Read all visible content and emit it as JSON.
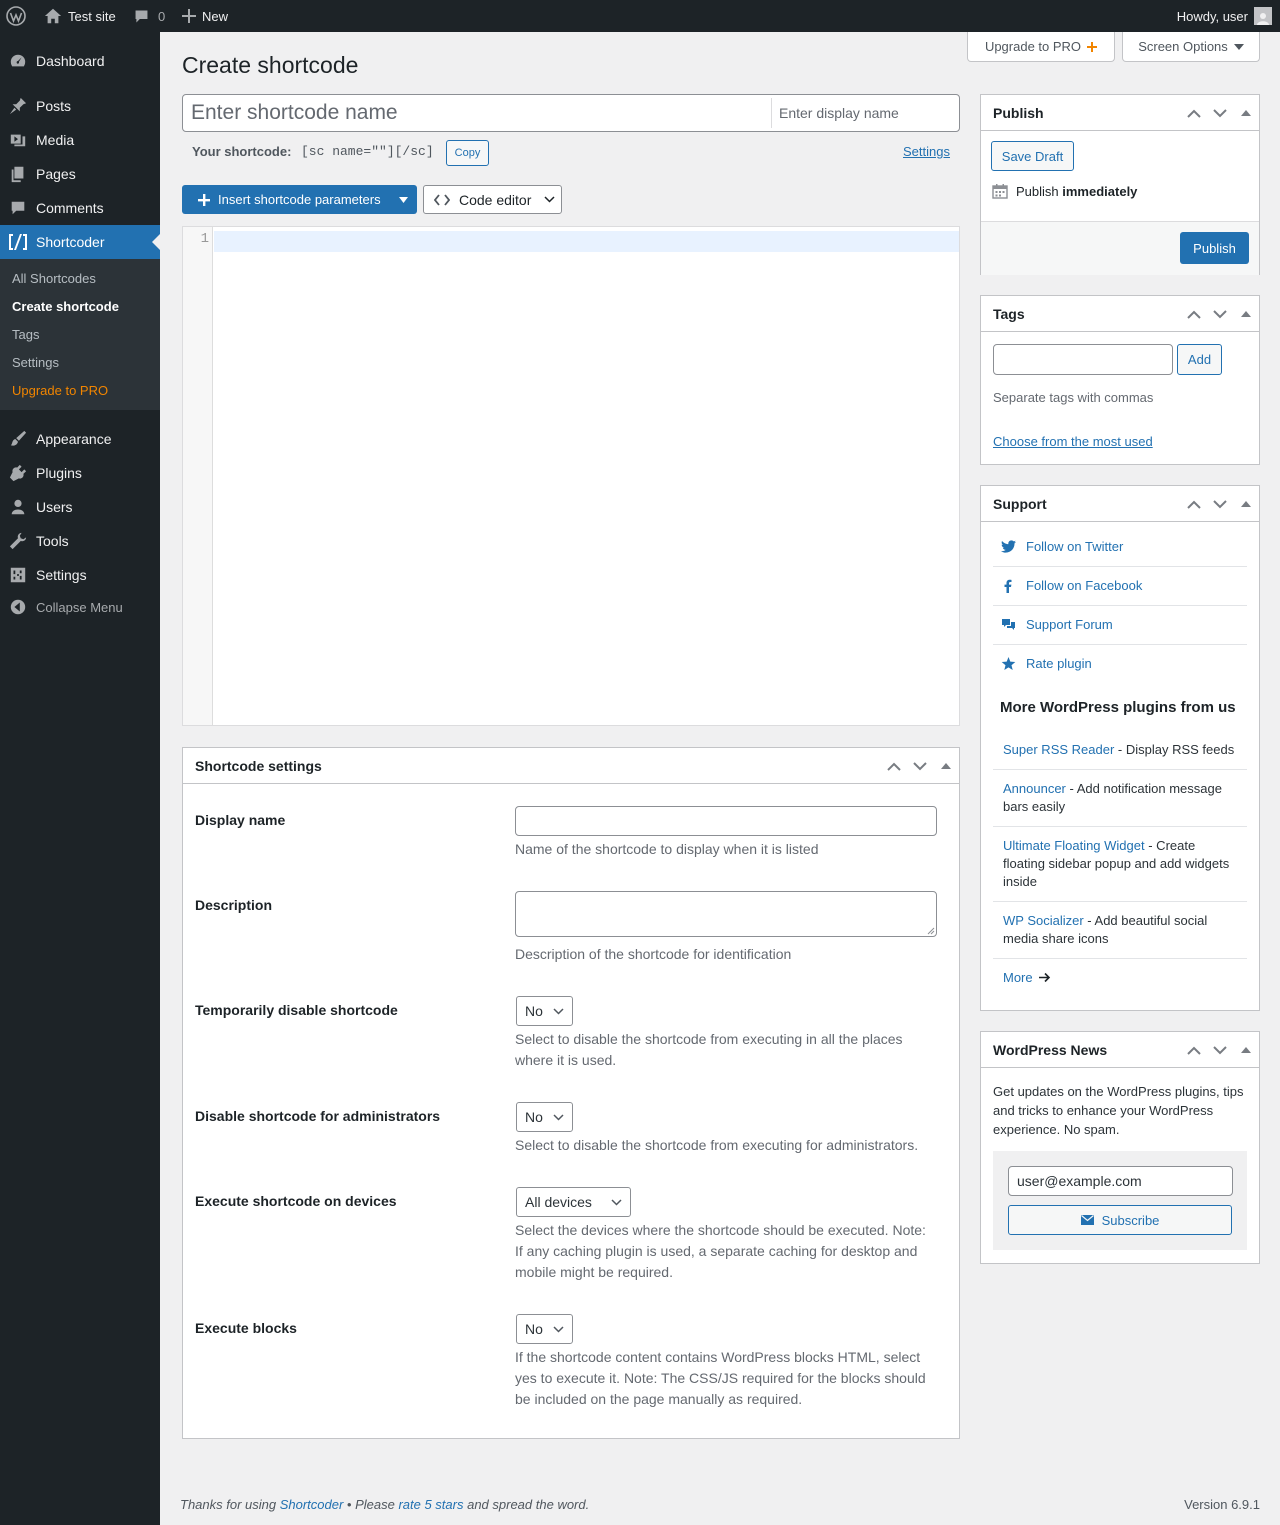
{
  "adminbar": {
    "site_name": "Test site",
    "comments_count": "0",
    "new_label": "New",
    "howdy": "Howdy, user"
  },
  "sidebar": {
    "items": [
      {
        "label": "Dashboard",
        "icon": "dashboard-icon"
      },
      {
        "label": "Posts",
        "icon": "pin-icon"
      },
      {
        "label": "Media",
        "icon": "media-icon"
      },
      {
        "label": "Pages",
        "icon": "pages-icon"
      },
      {
        "label": "Comments",
        "icon": "comment-icon"
      },
      {
        "label": "Shortcoder",
        "icon": "shortcoder-icon"
      },
      {
        "label": "Appearance",
        "icon": "brush-icon"
      },
      {
        "label": "Plugins",
        "icon": "plug-icon"
      },
      {
        "label": "Users",
        "icon": "user-icon"
      },
      {
        "label": "Tools",
        "icon": "wrench-icon"
      },
      {
        "label": "Settings",
        "icon": "settings-icon"
      }
    ],
    "submenu": [
      "All Shortcodes",
      "Create shortcode",
      "Tags",
      "Settings",
      "Upgrade to PRO"
    ],
    "collapse": "Collapse Menu"
  },
  "header": {
    "upgrade": "Upgrade to PRO",
    "screen_options": "Screen Options"
  },
  "editor": {
    "page_title": "Create shortcode",
    "name_placeholder": "Enter shortcode name",
    "display_placeholder": "Enter display name",
    "your_shortcode_label": "Your shortcode:",
    "shortcode_text": "[sc name=\"\"][/sc]",
    "copy": "Copy",
    "settings_link": "Settings",
    "insert_button": "Insert shortcode parameters",
    "code_editor": "Code editor",
    "line_number": "1"
  },
  "settings_box": {
    "title": "Shortcode settings",
    "rows": [
      {
        "label": "Display name",
        "desc": "Name of the shortcode to display when it is listed"
      },
      {
        "label": "Description",
        "desc": "Description of the shortcode for identification"
      },
      {
        "label": "Temporarily disable shortcode",
        "value": "No",
        "desc": "Select to disable the shortcode from executing in all the places where it is used."
      },
      {
        "label": "Disable shortcode for administrators",
        "value": "No",
        "desc": "Select to disable the shortcode from executing for administrators."
      },
      {
        "label": "Execute shortcode on devices",
        "value": "All devices",
        "desc": "Select the devices where the shortcode should be executed. Note: If any caching plugin is used, a separate caching for desktop and mobile might be required."
      },
      {
        "label": "Execute blocks",
        "value": "No",
        "desc": "If the shortcode content contains WordPress blocks HTML, select yes to execute it. Note: The CSS/JS required for the blocks should be included on the page manually as required."
      }
    ]
  },
  "publish": {
    "title": "Publish",
    "save_draft": "Save Draft",
    "publish_prefix": "Publish",
    "publish_when": "immediately",
    "publish_button": "Publish"
  },
  "tags": {
    "title": "Tags",
    "add": "Add",
    "hint": "Separate tags with commas",
    "choose": "Choose from the most used"
  },
  "support": {
    "title": "Support",
    "links": [
      "Follow on Twitter",
      "Follow on Facebook",
      "Support Forum",
      "Rate plugin"
    ],
    "more_heading": "More WordPress plugins from us",
    "plugins": [
      {
        "name": "Super RSS Reader",
        "desc": " - Display RSS feeds"
      },
      {
        "name": "Announcer",
        "desc": " - Add notification message bars easily"
      },
      {
        "name": "Ultimate Floating Widget",
        "desc": " - Create floating sidebar popup and add widgets inside"
      },
      {
        "name": "WP Socializer",
        "desc": " - Add beautiful social media share icons"
      }
    ],
    "more": "More"
  },
  "news": {
    "title": "WordPress News",
    "text": "Get updates on the WordPress plugins, tips and tricks to enhance your WordPress experience. No spam.",
    "email": "user@example.com",
    "subscribe": "Subscribe"
  },
  "footer": {
    "thanks": "Thanks for using ",
    "plugin": "Shortcoder",
    "please": " • Please ",
    "rate": "rate 5 stars",
    "spread": " and spread the word.",
    "version": "Version 6.9.1"
  },
  "colors": {
    "accent": "#2271b1",
    "admin_bar": "#1d2327",
    "pro_orange": "#f18500"
  }
}
